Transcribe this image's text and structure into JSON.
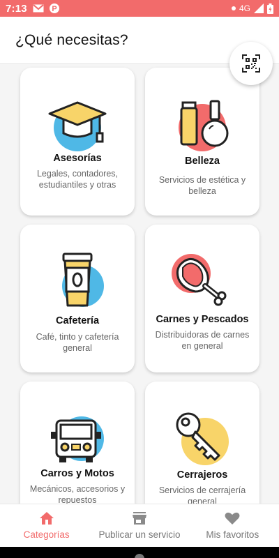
{
  "status": {
    "time": "7:13",
    "network": "4G"
  },
  "header": {
    "title": "¿Qué necesitas?"
  },
  "categories": [
    {
      "title": "Asesorías",
      "desc": "Legales, contadores, estudiantiles y otras"
    },
    {
      "title": "Belleza",
      "desc": "Servicios de estética y belleza"
    },
    {
      "title": "Cafetería",
      "desc": "Café, tinto y cafetería general"
    },
    {
      "title": "Carnes y Pescados",
      "desc": "Distribuidoras de carnes en general"
    },
    {
      "title": "Carros y Motos",
      "desc": "Mecánicos, accesorios y repuestos"
    },
    {
      "title": "Cerrajeros",
      "desc": "Servicios de cerrajería general"
    }
  ],
  "nav": [
    {
      "label": "Categorías",
      "icon": "home-icon",
      "active": true
    },
    {
      "label": "Publicar un servicio",
      "icon": "store-icon",
      "active": false
    },
    {
      "label": "Mis favoritos",
      "icon": "heart-icon",
      "active": false
    }
  ],
  "colors": {
    "accent": "#f26b6b",
    "blue": "#4fb8e6",
    "coral": "#f26b6b",
    "yellow": "#f8d469"
  }
}
